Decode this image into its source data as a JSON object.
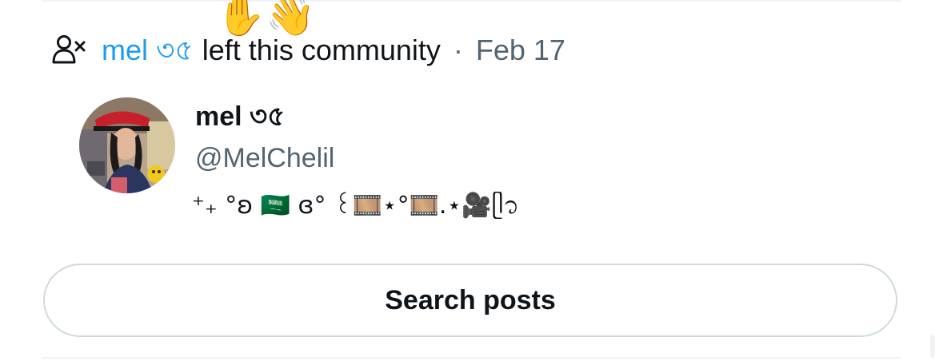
{
  "notification": {
    "icon": "person-x-icon",
    "user_name": "mel ৩৫",
    "action_text": "left this community",
    "separator": "·",
    "date": "Feb 17",
    "overlay_emoji": "✋👋"
  },
  "profile": {
    "display_name": "mel ৩৫",
    "handle": "@MelChelil",
    "bio": "⁺₊ °ʚ 🇸🇦 ɞ° ꒰🎞️⋆°🎞️.⋆🎥ᥫ᭡"
  },
  "actions": {
    "search_posts_label": "Search posts"
  },
  "colors": {
    "link": "#1d9bf0",
    "secondary_text": "#536471",
    "primary_text": "#0f1419",
    "border": "#cfd9de"
  }
}
